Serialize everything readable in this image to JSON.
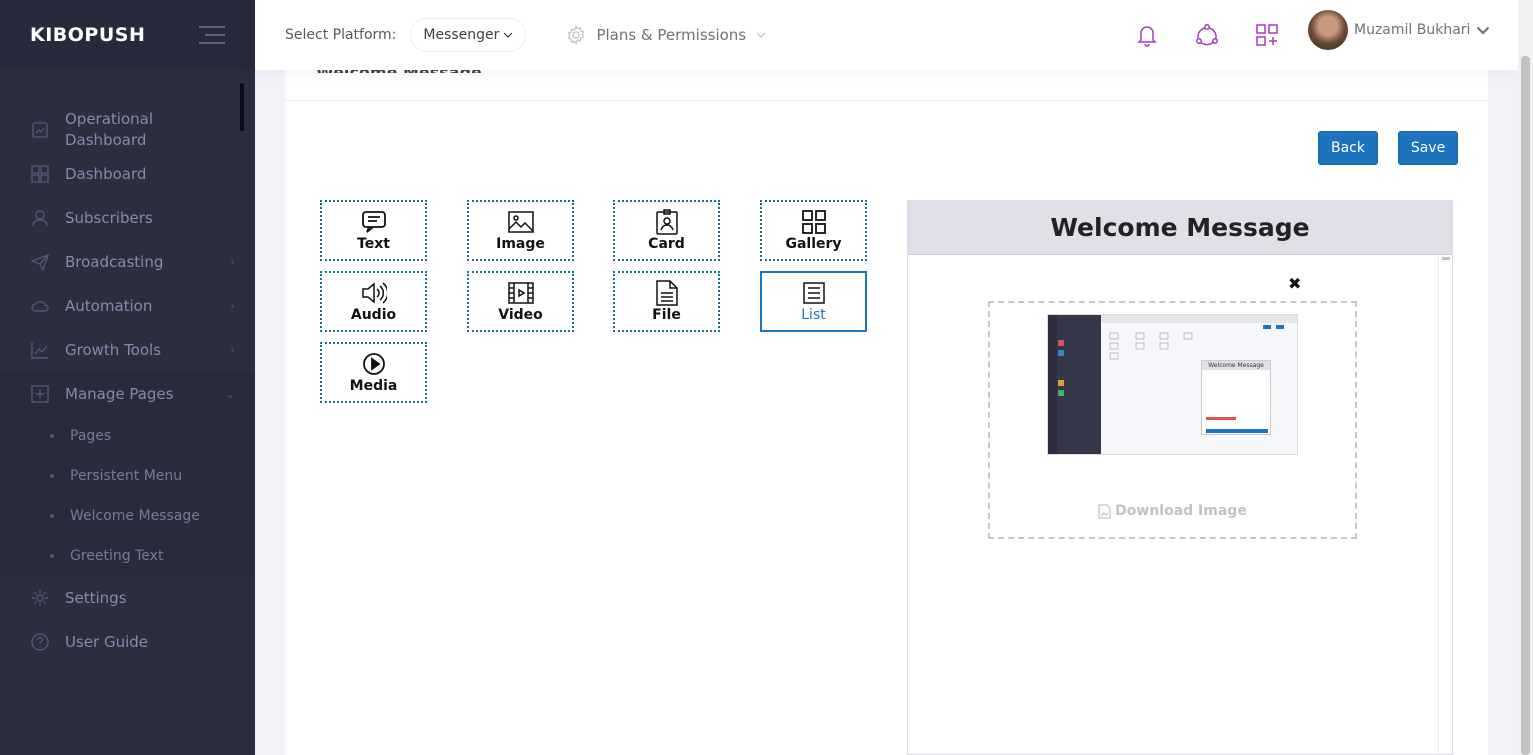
{
  "app": {
    "brand": "KIBOPUSH"
  },
  "sidebar": {
    "items": [
      {
        "label": "Operational Dashboard",
        "icon": "chart-icon"
      },
      {
        "label": "Dashboard",
        "icon": "grid-icon"
      },
      {
        "label": "Subscribers",
        "icon": "user-icon"
      },
      {
        "label": "Broadcasting",
        "icon": "paper-plane-icon"
      },
      {
        "label": "Automation",
        "icon": "cloud-icon"
      },
      {
        "label": "Growth Tools",
        "icon": "line-chart-icon"
      },
      {
        "label": "Manage Pages",
        "icon": "add-page-icon"
      },
      {
        "label": "Settings",
        "icon": "gear-icon"
      },
      {
        "label": "User Guide",
        "icon": "question-icon"
      }
    ],
    "manage_pages_sub": [
      "Pages",
      "Persistent Menu",
      "Welcome Message",
      "Greeting Text"
    ]
  },
  "header": {
    "platform_label": "Select Platform:",
    "platform_value": "Messenger",
    "plans_label": "Plans & Permissions",
    "user_name": "Muzamil Bukhari"
  },
  "portlet": {
    "title": "Welcome Message",
    "back_label": "Back",
    "save_label": "Save"
  },
  "components": [
    {
      "label": "Text",
      "icon": "chat-bubble-icon"
    },
    {
      "label": "Image",
      "icon": "image-icon"
    },
    {
      "label": "Card",
      "icon": "card-icon"
    },
    {
      "label": "Gallery",
      "icon": "gallery-icon"
    },
    {
      "label": "Audio",
      "icon": "speaker-icon"
    },
    {
      "label": "Video",
      "icon": "film-icon"
    },
    {
      "label": "File",
      "icon": "file-icon"
    },
    {
      "label": "List",
      "icon": "list-icon",
      "selected": true
    },
    {
      "label": "Media",
      "icon": "play-circle-icon"
    }
  ],
  "preview": {
    "title": "Welcome Message",
    "download_label": "Download Image",
    "thumbnail_title": "Welcome Message"
  },
  "colors": {
    "sidebar_bg": "#2c2e3e",
    "primary": "#1e73be",
    "component_border": "#1c6f8e",
    "header_icon": "#a23cbe"
  }
}
